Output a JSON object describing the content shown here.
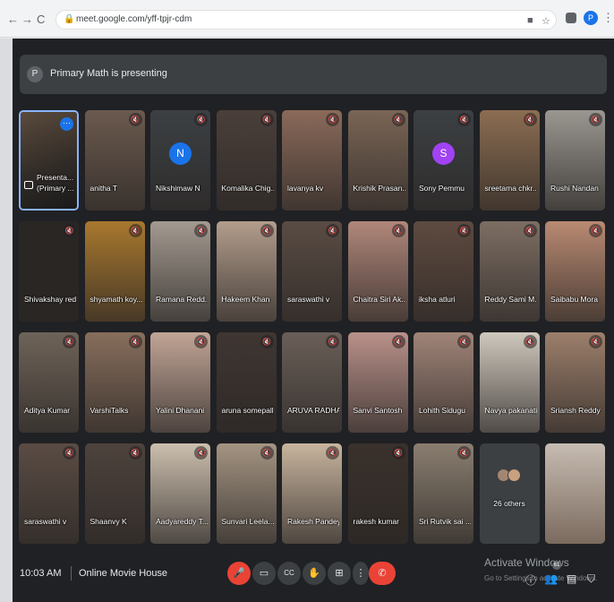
{
  "browser": {
    "url": "meet.google.com/yff-tpjr-cdm",
    "back_icon": "←",
    "forward_icon": "→",
    "reload_icon": "C",
    "lock_icon": "🔒",
    "profile_initial": "P",
    "star_icon": "☆",
    "cast_icon": "■",
    "kebab_icon": "⋮"
  },
  "banner": {
    "avatar_initial": "P",
    "text": "Primary Math is presenting"
  },
  "presenting_tile": {
    "line1": "Presenta...",
    "line2": "(Primary ..."
  },
  "participants": [
    {
      "name": "anitha T",
      "color": "#6b5a4e"
    },
    {
      "name": "Nikshimaw N",
      "letter": "N",
      "letter_bg": "#1a73e8",
      "color": "#3c4043"
    },
    {
      "name": "Komalika Chig...",
      "color": "#4a3f3a"
    },
    {
      "name": "lavanya kv",
      "color": "#8a6a5a"
    },
    {
      "name": "Krishik Prasan...",
      "color": "#7a6555"
    },
    {
      "name": "Sony Pemmu",
      "letter": "S",
      "letter_bg": "#a142f4",
      "color": "#3c4043"
    },
    {
      "name": "sreetama chkr...",
      "color": "#8c6d52"
    },
    {
      "name": "Rushi Nandan",
      "color": "#9a9690"
    },
    {
      "name": "Shivakshay red...",
      "color": "#2a2624"
    },
    {
      "name": "shyamath koy...",
      "color": "#a8782e"
    },
    {
      "name": "Ramana Redd...",
      "color": "#a39a90"
    },
    {
      "name": "Hakeem Khan",
      "color": "#b39d8c"
    },
    {
      "name": "saraswathi v",
      "color": "#5a4c44"
    },
    {
      "name": "Chaitra Siri Ak...",
      "color": "#b0877a"
    },
    {
      "name": "iksha atluri",
      "color": "#5e4a40"
    },
    {
      "name": "Reddy Sami M...",
      "color": "#7d6e63"
    },
    {
      "name": "Saibabu Mora",
      "color": "#b98a72"
    },
    {
      "name": "Aditya Kumar",
      "color": "#6e6358"
    },
    {
      "name": "VarshiTalks",
      "color": "#876e5c"
    },
    {
      "name": "Yalini Dhanani",
      "color": "#c2a596"
    },
    {
      "name": "aruna somepalli",
      "color": "#3f3632"
    },
    {
      "name": "ARUVA RADHA...",
      "color": "#6a5f58"
    },
    {
      "name": "Sanvi Santosh",
      "color": "#b9918a"
    },
    {
      "name": "Lohith Sidugu",
      "color": "#a08478"
    },
    {
      "name": "Navya pakanati",
      "color": "#cfc8bd"
    },
    {
      "name": "Sriansh Reddy",
      "color": "#9c7f6b"
    },
    {
      "name": "saraswathi v",
      "color": "#5a4c44"
    },
    {
      "name": "Shaanvy K",
      "color": "#4e433d"
    },
    {
      "name": "Aadyareddy T...",
      "color": "#ccbfae"
    },
    {
      "name": "Sunvari Leela...",
      "color": "#a49482"
    },
    {
      "name": "Rakesh Pandey",
      "color": "#c8b49e"
    },
    {
      "name": "rakesh kumar",
      "color": "#3a312c"
    },
    {
      "name": "Sri Rutvik sai ...",
      "color": "#8a7e70"
    }
  ],
  "others_tile": {
    "label": "26 others"
  },
  "last_tile": {
    "color": "#c7bcb2"
  },
  "bottom": {
    "time": "10:03 AM",
    "meeting_name": "Online Movie House",
    "activate_title": "Activate Windows",
    "activate_sub": "Go to Settings to activate Windows.",
    "participants_badge": "61",
    "controls": {
      "mic": "🎤",
      "camera": "▭",
      "captions": "CC",
      "raise_hand": "✋",
      "present": "⊞",
      "more": "⋮",
      "end_call": "✆"
    },
    "right_icons": {
      "info": "ⓘ",
      "people": "👥",
      "chat": "▤",
      "activities": "⛉"
    }
  }
}
